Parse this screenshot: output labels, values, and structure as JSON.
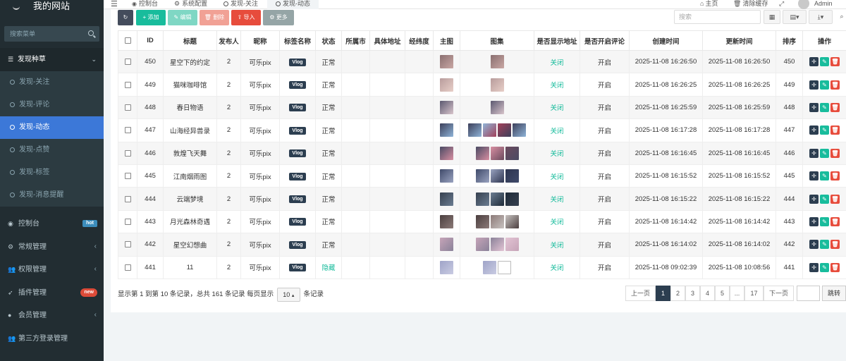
{
  "brand": {
    "title": "我的网站"
  },
  "sidebar": {
    "search_placeholder": "搜索菜单",
    "group": "发现种草",
    "sub_items": [
      "发现-关注",
      "发现-评论",
      "发现-动态",
      "发现-点赞",
      "发现-标签",
      "发现-消息提醒"
    ],
    "nav": [
      {
        "label": "控制台",
        "badge": "hot"
      },
      {
        "label": "常规管理",
        "caret": "‹"
      },
      {
        "label": "权限管理",
        "caret": "‹"
      },
      {
        "label": "插件管理",
        "badge": "new"
      },
      {
        "label": "会员管理",
        "caret": "‹"
      },
      {
        "label": "第三方登录管理"
      }
    ]
  },
  "topbar": {
    "tabs": [
      "控制台",
      "系统配置",
      "发现-关注",
      "发现-动态"
    ],
    "home": "主页",
    "clear_cache": "清除缓存",
    "user": "Admin"
  },
  "toolbar": {
    "add": "添加",
    "edit": "编辑",
    "delete": "删除",
    "import": "导入",
    "more": "更多",
    "search_placeholder": "搜索"
  },
  "table": {
    "headers": [
      "ID",
      "标题",
      "发布人",
      "昵称",
      "标签名称",
      "状态",
      "所属市",
      "具体地址",
      "经纬度",
      "主图",
      "图集",
      "是否显示地址",
      "是否开启评论",
      "创建时间",
      "更新时间",
      "排序",
      "操作"
    ],
    "rows": [
      {
        "id": "450",
        "title": "星空下的约定",
        "publisher": "2",
        "nickname": "可乐pix",
        "tag": "Vlog",
        "status": "正常",
        "show_addr": "关闭",
        "comment": "开启",
        "created": "2025-11-08 16:26:50",
        "updated": "2025-11-08 16:26:50",
        "sort": "450",
        "gallery": 1
      },
      {
        "id": "449",
        "title": "猫咪咖啡馆",
        "publisher": "2",
        "nickname": "可乐pix",
        "tag": "Vlog",
        "status": "正常",
        "show_addr": "关闭",
        "comment": "开启",
        "created": "2025-11-08 16:26:25",
        "updated": "2025-11-08 16:26:25",
        "sort": "449",
        "gallery": 1
      },
      {
        "id": "448",
        "title": "春日物语",
        "publisher": "2",
        "nickname": "可乐pix",
        "tag": "Vlog",
        "status": "正常",
        "show_addr": "关闭",
        "comment": "开启",
        "created": "2025-11-08 16:25:59",
        "updated": "2025-11-08 16:25:59",
        "sort": "448",
        "gallery": 1
      },
      {
        "id": "447",
        "title": "山海经异兽录",
        "publisher": "2",
        "nickname": "可乐pix",
        "tag": "Vlog",
        "status": "正常",
        "show_addr": "关闭",
        "comment": "开启",
        "created": "2025-11-08 16:17:28",
        "updated": "2025-11-08 16:17:28",
        "sort": "447",
        "gallery": 4
      },
      {
        "id": "446",
        "title": "敦煌飞天舞",
        "publisher": "2",
        "nickname": "可乐pix",
        "tag": "Vlog",
        "status": "正常",
        "show_addr": "关闭",
        "comment": "开启",
        "created": "2025-11-08 16:16:45",
        "updated": "2025-11-08 16:16:45",
        "sort": "446",
        "gallery": 3
      },
      {
        "id": "445",
        "title": "江南烟雨图",
        "publisher": "2",
        "nickname": "可乐pix",
        "tag": "Vlog",
        "status": "正常",
        "show_addr": "关闭",
        "comment": "开启",
        "created": "2025-11-08 16:15:52",
        "updated": "2025-11-08 16:15:52",
        "sort": "445",
        "gallery": 3
      },
      {
        "id": "444",
        "title": "云端梦境",
        "publisher": "2",
        "nickname": "可乐pix",
        "tag": "Vlog",
        "status": "正常",
        "show_addr": "关闭",
        "comment": "开启",
        "created": "2025-11-08 16:15:22",
        "updated": "2025-11-08 16:15:22",
        "sort": "444",
        "gallery": 3
      },
      {
        "id": "443",
        "title": "月光森林奇遇",
        "publisher": "2",
        "nickname": "可乐pix",
        "tag": "Vlog",
        "status": "正常",
        "show_addr": "关闭",
        "comment": "开启",
        "created": "2025-11-08 16:14:42",
        "updated": "2025-11-08 16:14:42",
        "sort": "443",
        "gallery": 3
      },
      {
        "id": "442",
        "title": "星空幻想曲",
        "publisher": "2",
        "nickname": "可乐pix",
        "tag": "Vlog",
        "status": "正常",
        "show_addr": "关闭",
        "comment": "开启",
        "created": "2025-11-08 16:14:02",
        "updated": "2025-11-08 16:14:02",
        "sort": "442",
        "gallery": 3
      },
      {
        "id": "441",
        "title": "11",
        "publisher": "2",
        "nickname": "可乐pix",
        "tag": "Vlog",
        "status": "隐藏",
        "show_addr": "关闭",
        "comment": "开启",
        "created": "2025-11-08 09:02:39",
        "updated": "2025-11-08 10:08:56",
        "sort": "441",
        "gallery": 2
      }
    ]
  },
  "footer": {
    "info_prefix": "显示第 1 到第 10 条记录，总共 161 条记录 每页显示",
    "page_size": "10",
    "info_suffix": "条记录",
    "prev": "上一页",
    "pages": [
      "1",
      "2",
      "3",
      "4",
      "5",
      "...",
      "17"
    ],
    "next": "下一页",
    "jump": "跳转"
  },
  "colors": {
    "sidebar_bg": "#222d32",
    "active_menu": "#3c78d8",
    "primary_green": "#18bc9c",
    "danger_red": "#e74c3c",
    "dark_button": "#2c3e50"
  }
}
